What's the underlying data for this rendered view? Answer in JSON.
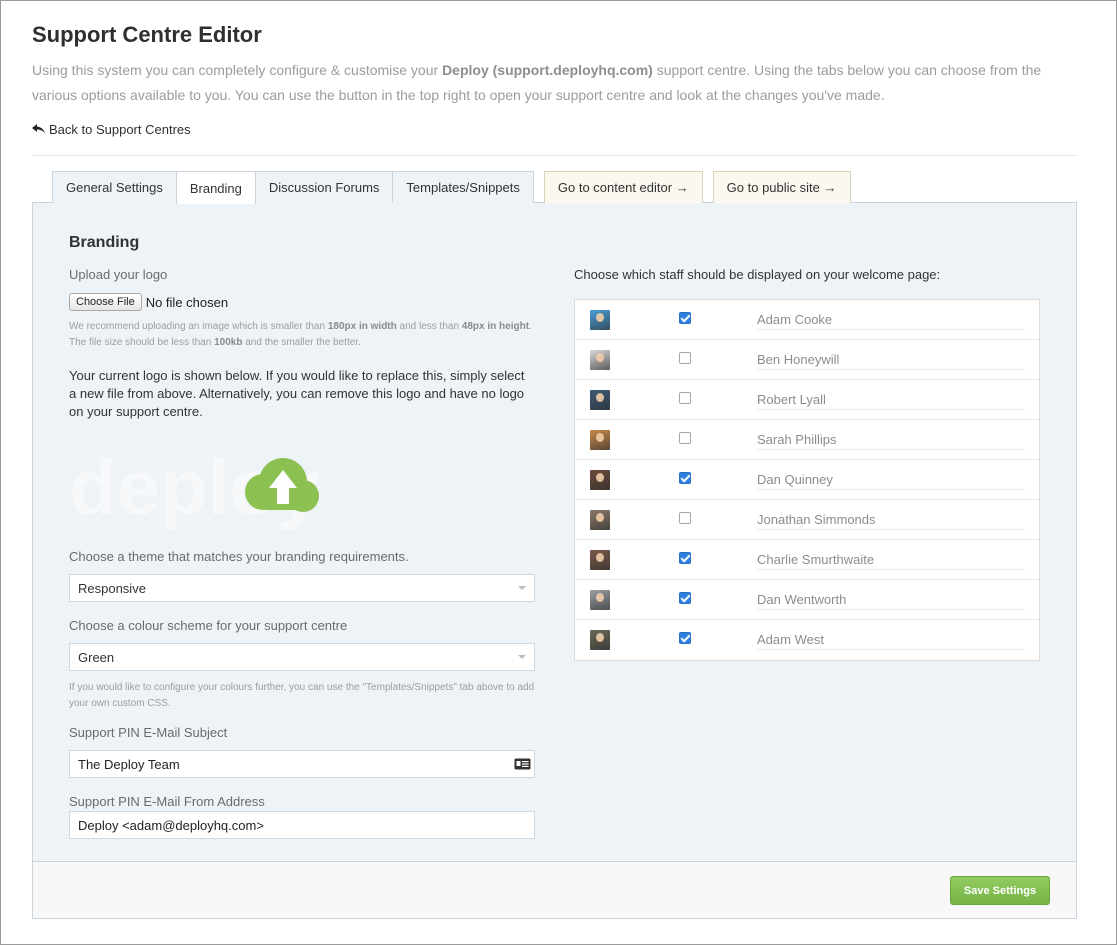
{
  "header": {
    "title": "Support Centre Editor",
    "intro_1": "Using this system you can completely configure & customise your ",
    "intro_bold": "Deploy (support.deployhq.com)",
    "intro_2": " support centre. Using the tabs below you can choose from the various options available to you. You can use the button in the top right to open your support centre and look at the changes you've made.",
    "back_label": "Back to Support Centres"
  },
  "tabs": [
    {
      "label": "General Settings"
    },
    {
      "label": "Branding"
    },
    {
      "label": "Discussion Forums"
    },
    {
      "label": "Templates/Snippets"
    }
  ],
  "link_tabs": [
    {
      "label": "Go to content editor →"
    },
    {
      "label": "Go to public site →"
    }
  ],
  "branding": {
    "section_title": "Branding",
    "upload_label": "Upload your logo",
    "file_button": "Choose File",
    "file_status": "No file chosen",
    "hint_1": "We recommend uploading an image which is smaller than ",
    "hint_w": "180px in width",
    "hint_2": " and less than ",
    "hint_h": "48px in height",
    "hint_3": ". The file size should be less than ",
    "hint_size": "100kb",
    "hint_4": " and the smaller the better.",
    "current_logo_text": "Your current logo is shown below. If you would like to replace this, simply select a new file from above. Alternatively, you can remove this logo and have no logo on your support centre.",
    "logo_word": "deploy",
    "theme_label": "Choose a theme that matches your branding requirements.",
    "theme_value": "Responsive",
    "colour_label": "Choose a colour scheme for your support centre",
    "colour_value": "Green",
    "colour_hint": "If you would like to configure your colours further, you can use the \"Templates/Snippets\" tab above to add your own custom CSS.",
    "pin_subject_label": "Support PIN E-Mail Subject",
    "pin_subject_value": "The Deploy Team",
    "pin_from_label": "Support PIN E-Mail From Address",
    "pin_from_value": "Deploy <adam@deployhq.com>"
  },
  "staff": {
    "title": "Choose which staff should be displayed on your welcome page:",
    "members": [
      {
        "name": "Adam Cooke",
        "checked": true,
        "avatar_color": "#4a9fd8"
      },
      {
        "name": "Ben Honeywill",
        "checked": false,
        "avatar_color": "#d8d8d8"
      },
      {
        "name": "Robert Lyall",
        "checked": false,
        "avatar_color": "#3d5a78"
      },
      {
        "name": "Sarah Phillips",
        "checked": false,
        "avatar_color": "#c98a4a"
      },
      {
        "name": "Dan Quinney",
        "checked": true,
        "avatar_color": "#6a4a3a"
      },
      {
        "name": "Jonathan Simmonds",
        "checked": false,
        "avatar_color": "#8a7a6a"
      },
      {
        "name": "Charlie Smurthwaite",
        "checked": true,
        "avatar_color": "#7a5a4a"
      },
      {
        "name": "Dan Wentworth",
        "checked": true,
        "avatar_color": "#9aa0a6"
      },
      {
        "name": "Adam West",
        "checked": true,
        "avatar_color": "#6a6a5a"
      }
    ]
  },
  "footer": {
    "save_label": "Save Settings"
  },
  "colors": {
    "accent_green": "#7dbb4e",
    "tab_bg": "#eef3f7",
    "checkbox_blue": "#2e7fe0"
  }
}
